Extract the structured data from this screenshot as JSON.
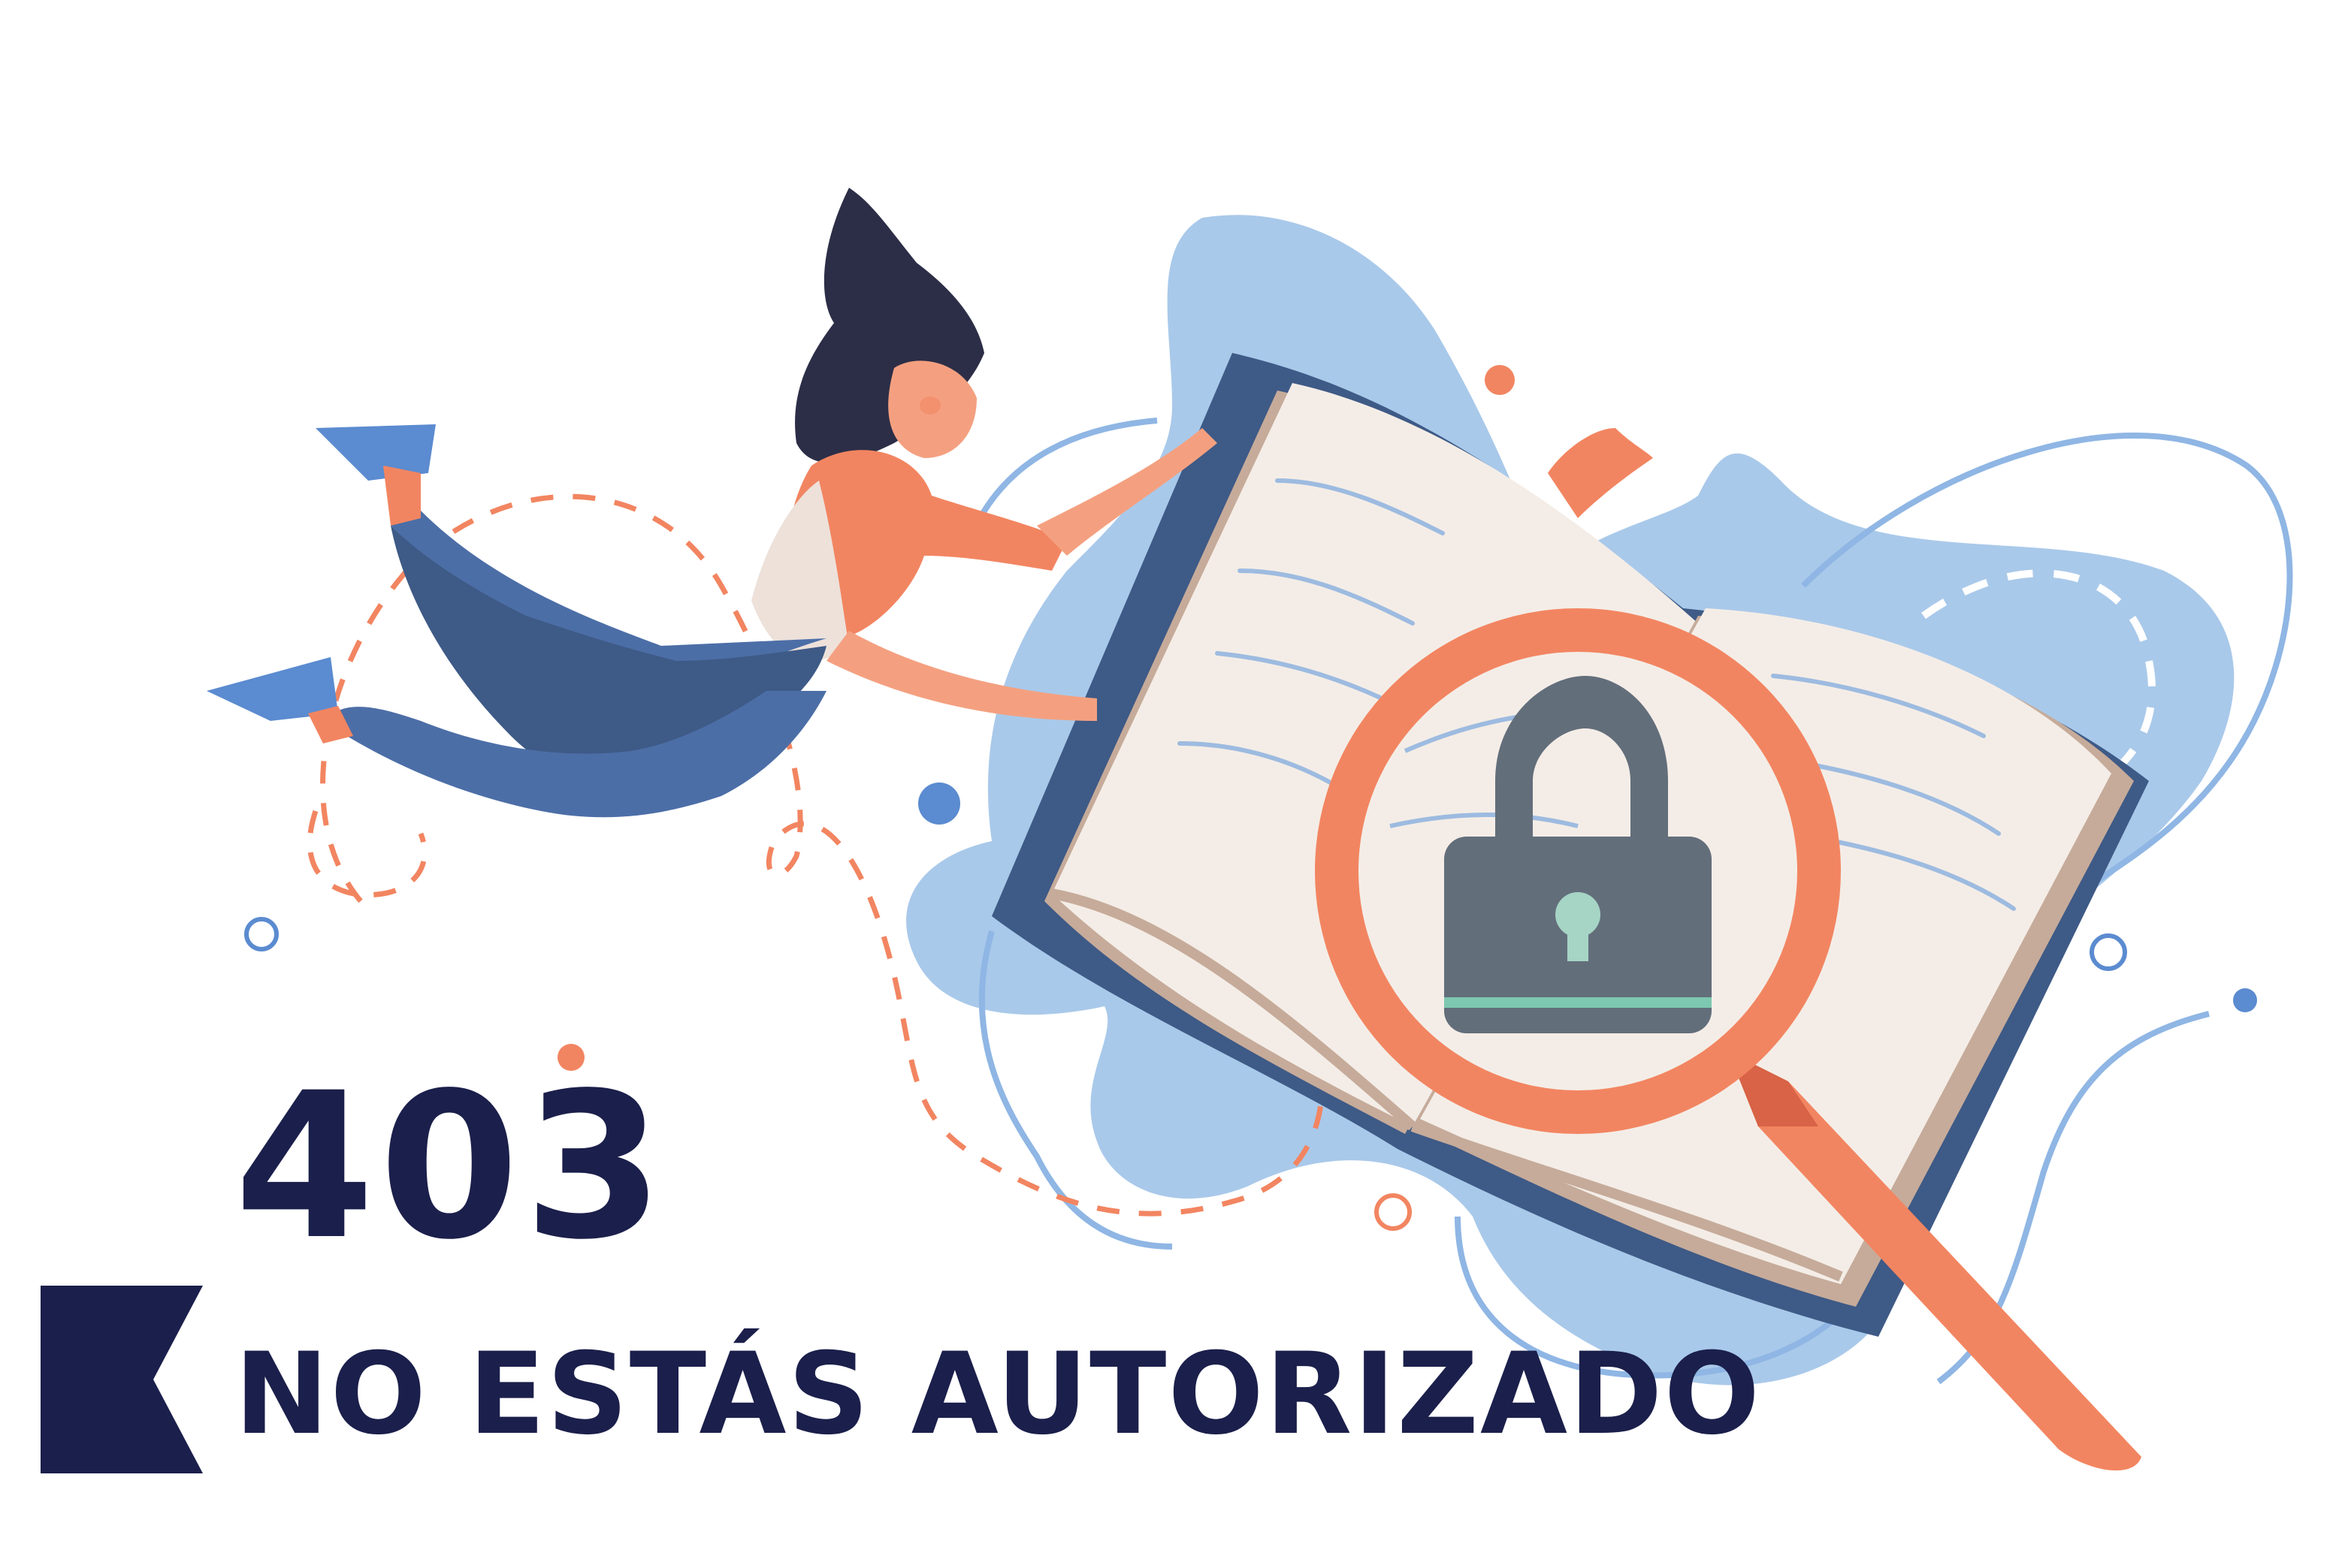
{
  "error": {
    "code": "403",
    "message": "NO ESTÁS AUTORIZADO"
  },
  "icons": [
    "flying-woman-illustration",
    "open-book-illustration",
    "magnifying-glass-icon",
    "padlock-icon",
    "brand-flag-logo"
  ],
  "colors": {
    "navy": "#1b1f4b",
    "coral": "#f28561",
    "sky_blob": "#a9c9ea",
    "sky_line": "#8fb6e4",
    "book_cover": "#3e5a86",
    "page": "#f4ede7",
    "lock_body": "#636e7b",
    "keyhole": "#a6d4c5",
    "hair": "#2c2e47",
    "jeans": "#4c6ea7",
    "skin": "#f4a080"
  }
}
